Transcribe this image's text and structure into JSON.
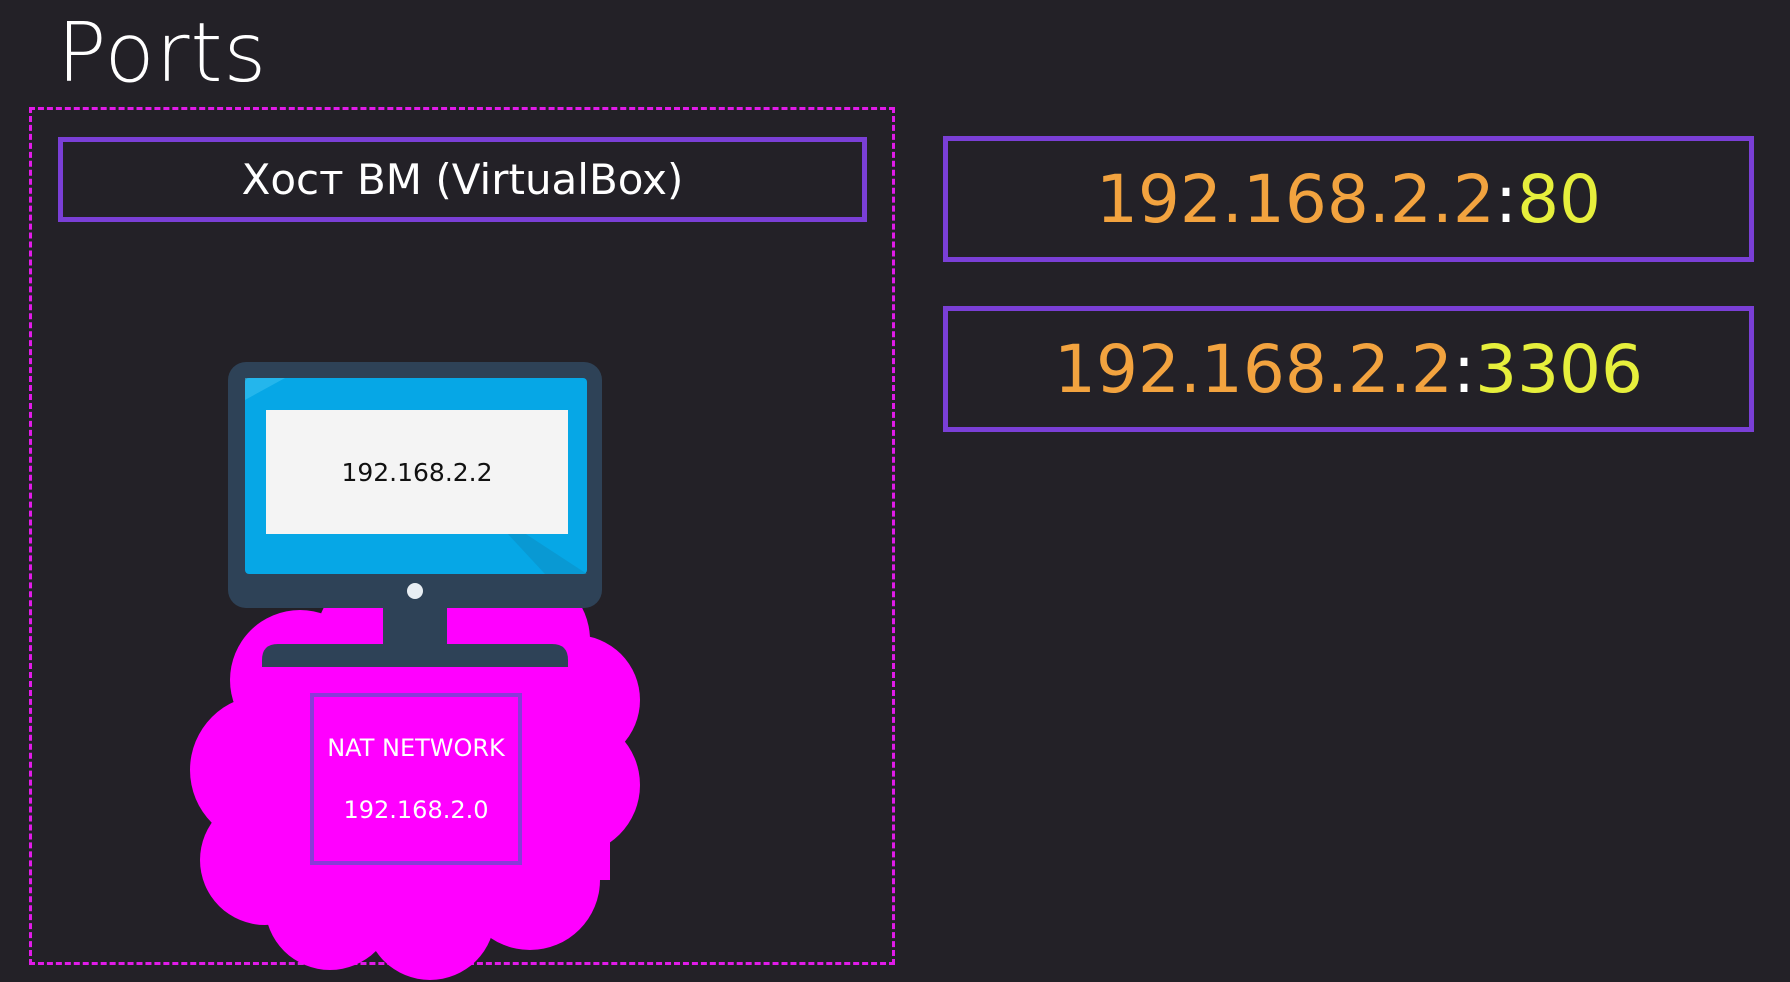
{
  "slide": {
    "title": "Ports"
  },
  "host": {
    "label": "Хост ВМ (VirtualBox)"
  },
  "computer": {
    "screen_text": "192.168.2.2"
  },
  "network": {
    "name": "NAT NETWORK",
    "address": "192.168.2.0"
  },
  "ports": [
    {
      "ip": "192.168.2.2",
      "separator": ":",
      "port": "80"
    },
    {
      "ip": "192.168.2.2",
      "separator": ":",
      "port": "3306"
    }
  ],
  "colors": {
    "background": "#232127",
    "frame_dashed": "#e01be8",
    "box_border": "#7a3fd6",
    "ip_text": "#f2a33f",
    "port_text": "#e6ef3c",
    "cloud": "#ff00ff",
    "monitor_frame": "#2e4257",
    "monitor_screen": "#06a7e6"
  }
}
